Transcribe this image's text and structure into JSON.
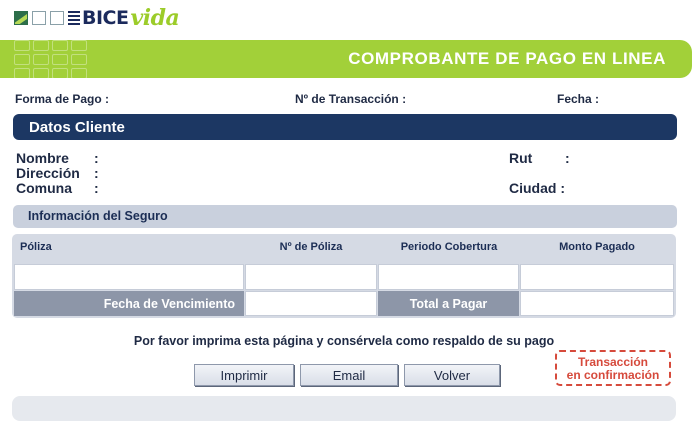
{
  "brand": {
    "bice": "BICE",
    "vida": "vida"
  },
  "header": {
    "title": "COMPROBANTE DE PAGO EN LINEA"
  },
  "payment_info": {
    "forma_pago_label": "Forma de Pago :",
    "transaccion_label": "Nº de Transacción :",
    "fecha_label": "Fecha :"
  },
  "cliente": {
    "section_title": "Datos Cliente",
    "nombre_label": "Nombre",
    "direccion_label": "Dirección",
    "comuna_label": "Comuna",
    "rut_label": "Rut",
    "ciudad_label": "Ciudad :",
    "colon": ":"
  },
  "seguro": {
    "section_title": "Información del Seguro",
    "columns": [
      "Póliza",
      "Nº de Póliza",
      "Periodo Cobertura",
      "Monto Pagado"
    ],
    "fecha_vencimiento_label": "Fecha de Vencimiento",
    "total_label": "Total a Pagar"
  },
  "note": "Por favor imprima esta página y consérvela como respaldo de su pago",
  "buttons": {
    "print": "Imprimir",
    "email": "Email",
    "back": "Volver"
  },
  "stamp": {
    "line1": "Transacción",
    "line2": "en confirmación"
  },
  "colors": {
    "brand_green": "#a2d039",
    "navy": "#1c3763",
    "stamp_red": "#d64a3c"
  }
}
